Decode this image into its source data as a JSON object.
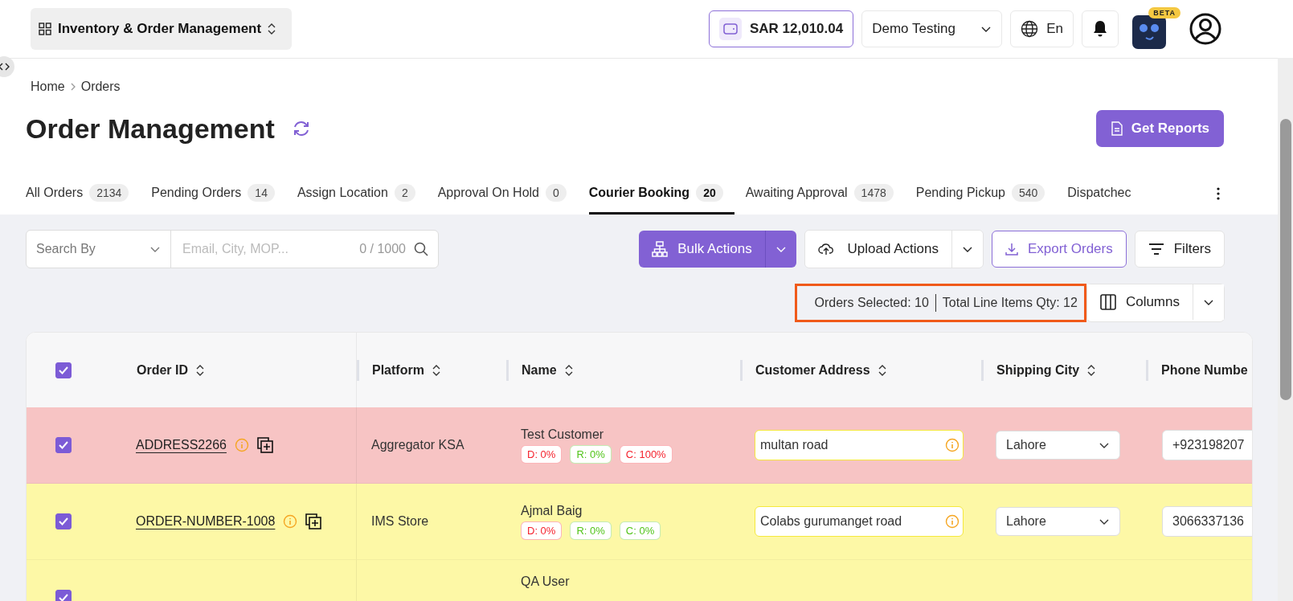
{
  "header": {
    "app_switcher": "Inventory & Order Management",
    "wallet": "SAR 12,010.04",
    "workspace": "Demo Testing",
    "language": "En",
    "assistant_badge": "BETA"
  },
  "breadcrumb": [
    "Home",
    "Orders"
  ],
  "page_title": "Order Management",
  "get_reports": "Get Reports",
  "tabs": [
    {
      "label": "All Orders",
      "count": "2134",
      "selected": false
    },
    {
      "label": "Pending Orders",
      "count": "14",
      "selected": false
    },
    {
      "label": "Assign Location",
      "count": "2",
      "selected": false
    },
    {
      "label": "Approval On Hold",
      "count": "0",
      "selected": false
    },
    {
      "label": "Courier Booking",
      "count": "20",
      "selected": true
    },
    {
      "label": "Awaiting Approval",
      "count": "1478",
      "selected": false
    },
    {
      "label": "Pending Pickup",
      "count": "540",
      "selected": false
    },
    {
      "label": "Dispatchec",
      "selected": false
    }
  ],
  "search": {
    "search_by": "Search By",
    "placeholder": "Email, City, MOP...",
    "counter": "0 / 1000"
  },
  "actions": {
    "bulk": "Bulk Actions",
    "upload": "Upload Actions",
    "export": "Export Orders",
    "filters": "Filters",
    "columns": "Columns"
  },
  "selection_summary": {
    "orders_selected": "Orders Selected: 10",
    "total_line_items": "Total Line Items Qty: 12"
  },
  "table": {
    "all_checked": true,
    "columns": [
      "Order ID",
      "Platform",
      "Name",
      "Customer Address",
      "Shipping City",
      "Phone Numbe"
    ],
    "rows": [
      {
        "checked": true,
        "color": "#f7c4c4",
        "order_id": "ADDRESS2266",
        "platform": "Aggregator KSA",
        "name": "Test Customer",
        "tags": [
          {
            "label": "D: 0%",
            "color": "#f5222d"
          },
          {
            "label": "R: 0%",
            "color": "#52c41a"
          },
          {
            "label": "C: 100%",
            "color": "#f5222d"
          }
        ],
        "address": "multan road",
        "address_warning": true,
        "city": "Lahore",
        "phone": "+923198207"
      },
      {
        "checked": true,
        "color": "#fdf8a6",
        "order_id": "ORDER-NUMBER-1008",
        "platform": "IMS Store",
        "name": "Ajmal Baig",
        "tags": [
          {
            "label": "D: 0%",
            "color": "#f5222d"
          },
          {
            "label": "R: 0%",
            "color": "#52c41a"
          },
          {
            "label": "C: 0%",
            "color": "#52c41a"
          }
        ],
        "address": "Colabs gurumanget road",
        "address_warning": true,
        "city": "Lahore",
        "phone": "3066337136"
      },
      {
        "checked": true,
        "color": "#fdf8a6",
        "name": "QA User"
      }
    ]
  }
}
